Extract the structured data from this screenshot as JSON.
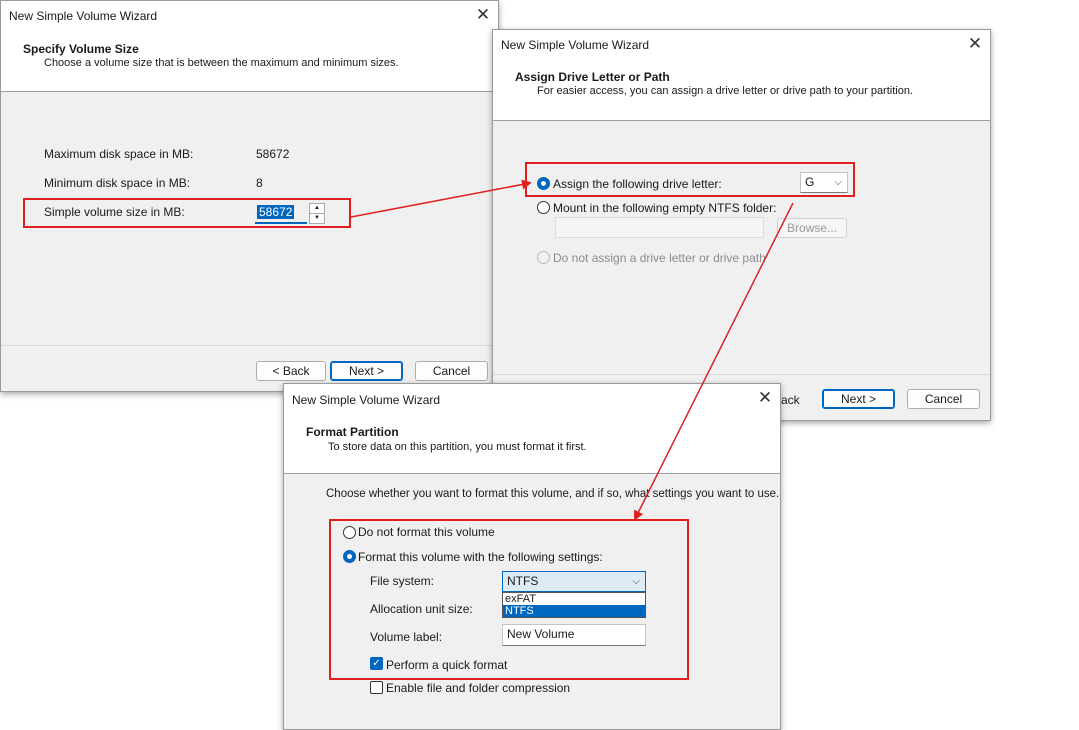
{
  "dialog1": {
    "title": "New Simple Volume Wizard",
    "heading": "Specify Volume Size",
    "subheading": "Choose a volume size that is between the maximum and minimum sizes.",
    "max_label": "Maximum disk space in MB:",
    "max_value": "58672",
    "min_label": "Minimum disk space in MB:",
    "min_value": "8",
    "size_label": "Simple volume size in MB:",
    "size_value": "58672",
    "back": "< Back",
    "next": "Next >",
    "cancel": "Cancel"
  },
  "dialog2": {
    "title": "New Simple Volume Wizard",
    "heading": "Assign Drive Letter or Path",
    "subheading": "For easier access, you can assign a drive letter or drive path to your partition.",
    "opt_assign": "Assign the following drive letter:",
    "drive_letter": "G",
    "opt_mount": "Mount in the following empty NTFS folder:",
    "browse": "Browse...",
    "opt_none": "Do not assign a drive letter or drive path",
    "back_partial": "ack",
    "next": "Next >",
    "cancel": "Cancel"
  },
  "dialog3": {
    "title": "New Simple Volume Wizard",
    "heading": "Format Partition",
    "subheading": "To store data on this partition, you must format it first.",
    "intro": "Choose whether you want to format this volume, and if so, what settings you want to use.",
    "opt_no_format": "Do not format this volume",
    "opt_format": "Format this volume with the following settings:",
    "fs_label": "File system:",
    "fs_value": "NTFS",
    "fs_options": [
      "exFAT",
      "NTFS"
    ],
    "alloc_label": "Allocation unit size:",
    "vol_label": "Volume label:",
    "vol_value": "New Volume",
    "quick_format": "Perform a quick format",
    "compression": "Enable file and folder compression"
  },
  "colors": {
    "accent": "#0067c0",
    "highlight": "#e02020"
  }
}
